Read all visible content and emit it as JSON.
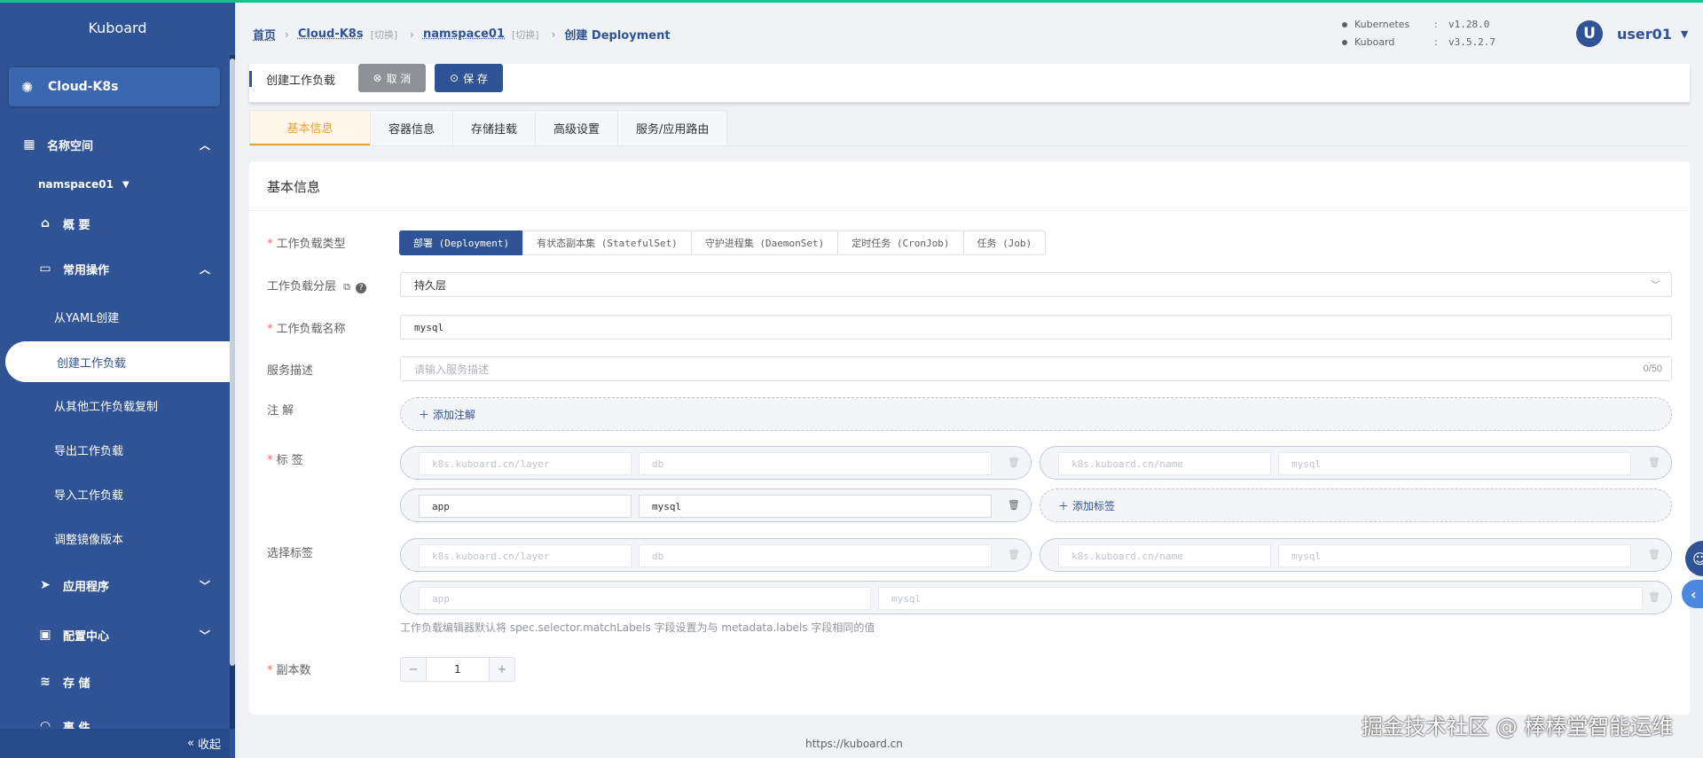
{
  "app": {
    "title": "Kuboard",
    "cluster": "Cloud-K8s"
  },
  "sidebar": {
    "namespace_section": "名称空间",
    "namespace": "namspace01",
    "overview": "概 要",
    "common_ops": "常用操作",
    "items": [
      {
        "label": "从YAML创建"
      },
      {
        "label": "创建工作负载"
      },
      {
        "label": "从其他工作负载复制"
      },
      {
        "label": "导出工作负载"
      },
      {
        "label": "导入工作负载"
      },
      {
        "label": "调整镜像版本"
      }
    ],
    "apps": "应用程序",
    "config": "配置中心",
    "storage": "存 储",
    "events": "事 件",
    "collapse": "收起"
  },
  "breadcrumb": {
    "home": "首页",
    "cluster": "Cloud-K8s",
    "switch": "[切换]",
    "namespace": "namspace01",
    "current": "创建 Deployment"
  },
  "versions": [
    {
      "name": "Kubernetes",
      "value": "v1.28.0"
    },
    {
      "name": "Kuboard",
      "value": "v3.5.2.7"
    }
  ],
  "user": {
    "initial": "U",
    "name": "user01"
  },
  "toolbar": {
    "title": "创建工作负载",
    "cancel": "取 消",
    "save": "保 存"
  },
  "tabs": [
    {
      "label": "基本信息",
      "active": true
    },
    {
      "label": "容器信息"
    },
    {
      "label": "存储挂载"
    },
    {
      "label": "高级设置"
    },
    {
      "label": "服务/应用路由"
    }
  ],
  "form": {
    "header": "基本信息",
    "workload_type": {
      "label": "工作负载类型",
      "options": [
        "部署 (Deployment)",
        "有状态副本集 (StatefulSet)",
        "守护进程集 (DaemonSet)",
        "定时任务 (CronJob)",
        "任务 (Job)"
      ],
      "selected": "部署 (Deployment)"
    },
    "layer": {
      "label": "工作负载分层",
      "value": "持久层"
    },
    "name": {
      "label": "工作负载名称",
      "value": "mysql"
    },
    "description": {
      "label": "服务描述",
      "placeholder": "请输入服务描述",
      "count": "0/50"
    },
    "annotations": {
      "label": "注 解",
      "add": "添加注解"
    },
    "labels": {
      "label": "标 签",
      "rows": [
        {
          "key": "k8s.kuboard.cn/layer",
          "value": "db"
        },
        {
          "key": "k8s.kuboard.cn/name",
          "value": "mysql"
        },
        {
          "key": "app",
          "value": "mysql"
        }
      ],
      "add": "添加标签"
    },
    "selector": {
      "label": "选择标签",
      "rows": [
        {
          "key": "k8s.kuboard.cn/layer",
          "value": "db"
        },
        {
          "key": "k8s.kuboard.cn/name",
          "value": "mysql"
        },
        {
          "key": "app",
          "value": "mysql"
        }
      ],
      "hint": "工作负载编辑器默认将 spec.selector.matchLabels 字段设置为与 metadata.labels 字段相同的值"
    },
    "replicas": {
      "label": "副本数",
      "value": "1",
      "minus": "−",
      "plus": "+"
    }
  },
  "footer": {
    "url": "https://kuboard.cn"
  },
  "watermark": "掘金技术社区 @ 棒棒堂智能运维",
  "colors": {
    "primary": "#2f5394",
    "accent": "#e6a23c",
    "top_line": "#1ac08f",
    "required": "#f56c6c"
  }
}
